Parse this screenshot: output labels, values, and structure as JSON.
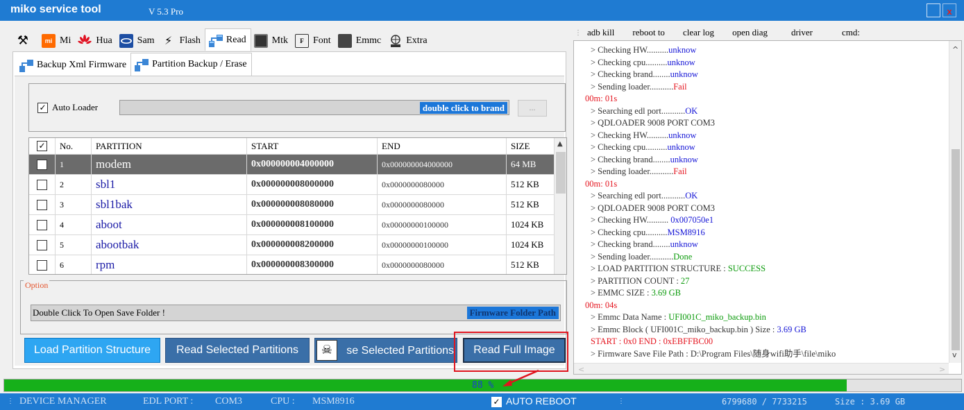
{
  "window": {
    "title": "miko service tool",
    "version": "V 5.3 Pro",
    "close_glyph": "x"
  },
  "main_tabs": [
    {
      "label": "",
      "icon": "tools-icon"
    },
    {
      "label": "Mi",
      "icon": "mi-icon"
    },
    {
      "label": "Hua",
      "icon": "huawei-icon"
    },
    {
      "label": "Sam",
      "icon": "samsung-icon"
    },
    {
      "label": "Flash",
      "icon": "flash-icon"
    },
    {
      "label": "Read",
      "icon": "network-icon",
      "active": true
    },
    {
      "label": "Mtk",
      "icon": "chip-icon"
    },
    {
      "label": "Font",
      "icon": "font-icon"
    },
    {
      "label": "Emmc",
      "icon": "emmc-icon"
    },
    {
      "label": "Extra",
      "icon": "extra-icon"
    }
  ],
  "sub_tabs": [
    {
      "label": "Backup Xml Firmware",
      "icon": "network-icon"
    },
    {
      "label": "Partition Backup / Erase",
      "icon": "network-icon",
      "active": true
    }
  ],
  "loader": {
    "auto_loader_label": "Auto Loader",
    "auto_loader_checked": true,
    "hint": "double click to brand",
    "browse_label": "..."
  },
  "table": {
    "headers": {
      "check": "☑",
      "no": "No.",
      "partition": "PARTITION",
      "start": "START",
      "end": "END",
      "size": "SIZE"
    },
    "rows": [
      {
        "no": "1",
        "partition": "modem",
        "start": "0x000000004000000",
        "end": "0x000000004000000",
        "size": "64 MB",
        "selected": true
      },
      {
        "no": "2",
        "partition": "sbl1",
        "start": "0x000000008000000",
        "end": "0x0000000080000",
        "size": "512 KB"
      },
      {
        "no": "3",
        "partition": "sbl1bak",
        "start": "0x000000008080000",
        "end": "0x0000000080000",
        "size": "512 KB"
      },
      {
        "no": "4",
        "partition": "aboot",
        "start": "0x000000008100000",
        "end": "0x00000000100000",
        "size": "1024 KB"
      },
      {
        "no": "5",
        "partition": "abootbak",
        "start": "0x000000008200000",
        "end": "0x00000000100000",
        "size": "1024 KB"
      },
      {
        "no": "6",
        "partition": "rpm",
        "start": "0x000000008300000",
        "end": "0x0000000080000",
        "size": "512 KB"
      }
    ]
  },
  "option": {
    "title": "Option",
    "save_text": "Double Click To Open Save Folder !",
    "save_hint": "Firmware Folder Path"
  },
  "buttons": {
    "load": "Load Partition Structure",
    "read_selected": "Read Selected Partitions",
    "erase_selected": "se Selected Partitions",
    "read_full": "Read Full Image"
  },
  "cmd_bar": {
    "items": [
      "adb kill",
      "reboot to",
      "clear log",
      "open diag",
      "driver",
      "cmd:"
    ]
  },
  "log": [
    {
      "type": "sub",
      "parts": [
        {
          "t": "> Checking HW..........",
          "c": "dark"
        },
        {
          "t": "unknow",
          "c": "blue"
        }
      ]
    },
    {
      "type": "sub",
      "parts": [
        {
          "t": "> Checking cpu..........",
          "c": "dark"
        },
        {
          "t": "unknow",
          "c": "blue"
        }
      ]
    },
    {
      "type": "sub",
      "parts": [
        {
          "t": "> Checking brand........",
          "c": "dark"
        },
        {
          "t": "unknow",
          "c": "blue"
        }
      ]
    },
    {
      "type": "sub",
      "parts": [
        {
          "t": "> Sending loader...........",
          "c": "dark"
        },
        {
          "t": "Fail",
          "c": "red"
        }
      ]
    },
    {
      "type": "time",
      "parts": [
        {
          "t": "00m: 01s",
          "c": "red"
        }
      ]
    },
    {
      "type": "sub",
      "parts": [
        {
          "t": "> Searching edl port...........",
          "c": "dark"
        },
        {
          "t": "OK",
          "c": "blue"
        }
      ]
    },
    {
      "type": "sub",
      "parts": [
        {
          "t": "> QDLOADER 9008 PORT COM3",
          "c": "dark"
        }
      ]
    },
    {
      "type": "sub",
      "parts": [
        {
          "t": "> Checking HW..........",
          "c": "dark"
        },
        {
          "t": "unknow",
          "c": "blue"
        }
      ]
    },
    {
      "type": "sub",
      "parts": [
        {
          "t": "> Checking cpu..........",
          "c": "dark"
        },
        {
          "t": "unknow",
          "c": "blue"
        }
      ]
    },
    {
      "type": "sub",
      "parts": [
        {
          "t": "> Checking brand........",
          "c": "dark"
        },
        {
          "t": "unknow",
          "c": "blue"
        }
      ]
    },
    {
      "type": "sub",
      "parts": [
        {
          "t": "> Sending loader...........",
          "c": "dark"
        },
        {
          "t": "Fail",
          "c": "red"
        }
      ]
    },
    {
      "type": "time",
      "parts": [
        {
          "t": "00m: 01s",
          "c": "red"
        }
      ]
    },
    {
      "type": "sub",
      "parts": [
        {
          "t": "> Searching edl port...........",
          "c": "dark"
        },
        {
          "t": "OK",
          "c": "blue"
        }
      ]
    },
    {
      "type": "sub",
      "parts": [
        {
          "t": "> QDLOADER 9008 PORT COM3",
          "c": "dark"
        }
      ]
    },
    {
      "type": "sub",
      "parts": [
        {
          "t": "> Checking HW.......... ",
          "c": "dark"
        },
        {
          "t": "0x007050e1",
          "c": "blue"
        }
      ]
    },
    {
      "type": "sub",
      "parts": [
        {
          "t": "> Checking cpu..........",
          "c": "dark"
        },
        {
          "t": "MSM8916",
          "c": "blue"
        }
      ]
    },
    {
      "type": "sub",
      "parts": [
        {
          "t": "> Checking brand........",
          "c": "dark"
        },
        {
          "t": "unknow",
          "c": "blue"
        }
      ]
    },
    {
      "type": "sub",
      "parts": [
        {
          "t": "> Sending loader...........",
          "c": "dark"
        },
        {
          "t": "Done",
          "c": "green"
        }
      ]
    },
    {
      "type": "sub",
      "parts": [
        {
          "t": "> LOAD PARTITION  STRUCTURE  :  ",
          "c": "dark"
        },
        {
          "t": "SUCCESS",
          "c": "green"
        }
      ]
    },
    {
      "type": "sub",
      "parts": [
        {
          "t": "> PARTITION COUNT  :  ",
          "c": "dark"
        },
        {
          "t": "27",
          "c": "green"
        }
      ]
    },
    {
      "type": "sub",
      "parts": [
        {
          "t": "> EMMC SIZE   :  ",
          "c": "dark"
        },
        {
          "t": "3.69 GB",
          "c": "green"
        }
      ]
    },
    {
      "type": "time",
      "parts": [
        {
          "t": "00m: 04s",
          "c": "red"
        }
      ]
    },
    {
      "type": "sub",
      "parts": [
        {
          "t": "> Emmc Data Name  :  ",
          "c": "dark"
        },
        {
          "t": "UFI001C_miko_backup.bin",
          "c": "green"
        }
      ]
    },
    {
      "type": "sub",
      "parts": [
        {
          "t": "> Emmc Block ( UFI001C_miko_backup.bin ) Size   :  ",
          "c": "dark"
        },
        {
          "t": "3.69 GB",
          "c": "blue"
        }
      ]
    },
    {
      "type": "sub",
      "parts": [
        {
          "t": " START  :  0x0     END :    0xEBFFBC00",
          "c": "red"
        }
      ]
    },
    {
      "type": "sub",
      "parts": [
        {
          "t": "> Firmware Save File  Path : D:\\Program Files\\随身wifi助手\\file\\miko",
          "c": "dark"
        }
      ]
    }
  ],
  "progress": {
    "percent": 88,
    "text": "88 %"
  },
  "status": {
    "device_manager": "DEVICE MANAGER",
    "edl_port_label": "EDL PORT :",
    "edl_port_value": "COM3",
    "cpu_label": "CPU :",
    "cpu_value": "MSM8916",
    "auto_reboot_label": "AUTO REBOOT",
    "auto_reboot_checked": true,
    "blocks": "6799680   /   7733215",
    "size": "Size  :  3.69 GB"
  },
  "colors": {
    "accent": "#1f7bd2",
    "progress": "#16b01a",
    "highlight": "#e0141e"
  }
}
